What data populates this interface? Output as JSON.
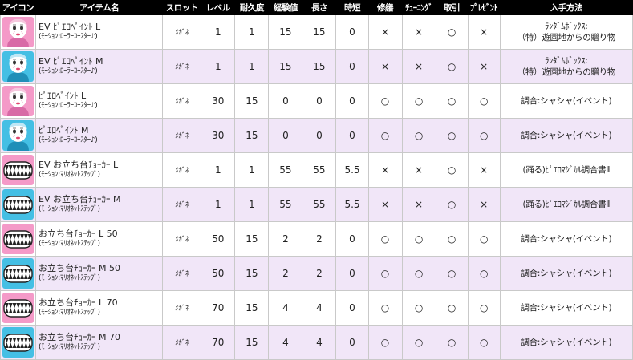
{
  "table": {
    "headers": [
      "アイコン",
      "アイテム名",
      "スロット",
      "レベル",
      "耐久度",
      "経験値",
      "長さ",
      "時短",
      "修繕",
      "ﾁｭｰﾆﾝｸﾞ",
      "取引",
      "ﾌﾟﾚｾﾞﾝﾄ",
      "入手方法"
    ],
    "rows": [
      {
        "icon": "face-pink-icon",
        "bg": "pink",
        "name": "EV ﾋﾟｴﾛﾍﾟｲﾝﾄ L",
        "sub": "(ﾓｰｼｮﾝ:ﾛｰﾗｰｺｰｽﾀｰ♪)",
        "slot": "ﾒｶﾞﾈ",
        "level": "1",
        "durability": "1",
        "exp": "15",
        "length": "15",
        "short": "0",
        "repair": "×",
        "tuning": "×",
        "trade": "○",
        "present": "×",
        "method1": "ﾗﾝﾀﾞﾑﾎﾞｯｸｽ:",
        "method2": "（特）遊園地からの贈り物"
      },
      {
        "icon": "face-blue-icon",
        "bg": "blue",
        "name": "EV ﾋﾟｴﾛﾍﾟｲﾝﾄ M",
        "sub": "(ﾓｰｼｮﾝ:ﾛｰﾗｰｺｰｽﾀｰ♪)",
        "slot": "ﾒｶﾞﾈ",
        "level": "1",
        "durability": "1",
        "exp": "15",
        "length": "15",
        "short": "0",
        "repair": "×",
        "tuning": "×",
        "trade": "○",
        "present": "×",
        "method1": "ﾗﾝﾀﾞﾑﾎﾞｯｸｽ:",
        "method2": "（特）遊園地からの贈り物"
      },
      {
        "icon": "face-pink-icon",
        "bg": "pink",
        "name": "ﾋﾟｴﾛﾍﾟｲﾝﾄ L",
        "sub": "(ﾓｰｼｮﾝ:ﾛｰﾗｰｺｰｽﾀｰ♪)",
        "slot": "ﾒｶﾞﾈ",
        "level": "30",
        "durability": "15",
        "exp": "0",
        "length": "0",
        "short": "0",
        "repair": "○",
        "tuning": "○",
        "trade": "○",
        "present": "○",
        "method1": "調合:シャシャ(イベント)",
        "method2": ""
      },
      {
        "icon": "face-blue-icon",
        "bg": "blue",
        "name": "ﾋﾟｴﾛﾍﾟｲﾝﾄ M",
        "sub": "(ﾓｰｼｮﾝ:ﾛｰﾗｰｺｰｽﾀｰ♪)",
        "slot": "ﾒｶﾞﾈ",
        "level": "30",
        "durability": "15",
        "exp": "0",
        "length": "0",
        "short": "0",
        "repair": "○",
        "tuning": "○",
        "trade": "○",
        "present": "○",
        "method1": "調合:シャシャ(イベント)",
        "method2": ""
      },
      {
        "icon": "mouth-pink-icon",
        "bg": "pink",
        "name": "EV お立ち台ﾁｮｰｶｰ L",
        "sub": "(ﾓｰｼｮﾝ:ﾏﾘｵﾈｯﾄｽﾃｯﾌﾟ)",
        "slot": "ﾒｶﾞﾈ",
        "level": "1",
        "durability": "1",
        "exp": "55",
        "length": "55",
        "short": "5.5",
        "repair": "×",
        "tuning": "×",
        "trade": "○",
        "present": "×",
        "method1": "(踊る)ﾋﾟｴﾛﾏｼﾞｶﾙ調合書Ⅱ",
        "method2": ""
      },
      {
        "icon": "mouth-blue-icon",
        "bg": "blue",
        "name": "EV お立ち台ﾁｮｰｶｰ M",
        "sub": "(ﾓｰｼｮﾝ:ﾏﾘｵﾈｯﾄｽﾃｯﾌﾟ)",
        "slot": "ﾒｶﾞﾈ",
        "level": "1",
        "durability": "1",
        "exp": "55",
        "length": "55",
        "short": "5.5",
        "repair": "×",
        "tuning": "×",
        "trade": "○",
        "present": "×",
        "method1": "(踊る)ﾋﾟｴﾛﾏｼﾞｶﾙ調合書Ⅱ",
        "method2": ""
      },
      {
        "icon": "mouth-pink-icon",
        "bg": "pink",
        "name": "お立ち台ﾁｮｰｶｰ L 50",
        "sub": "(ﾓｰｼｮﾝ:ﾏﾘｵﾈｯﾄｽﾃｯﾌﾟ)",
        "slot": "ﾒｶﾞﾈ",
        "level": "50",
        "durability": "15",
        "exp": "2",
        "length": "2",
        "short": "0",
        "repair": "○",
        "tuning": "○",
        "trade": "○",
        "present": "○",
        "method1": "調合:シャシャ(イベント)",
        "method2": ""
      },
      {
        "icon": "mouth-blue-icon",
        "bg": "blue",
        "name": "お立ち台ﾁｮｰｶｰ M 50",
        "sub": "(ﾓｰｼｮﾝ:ﾏﾘｵﾈｯﾄｽﾃｯﾌﾟ)",
        "slot": "ﾒｶﾞﾈ",
        "level": "50",
        "durability": "15",
        "exp": "2",
        "length": "2",
        "short": "0",
        "repair": "○",
        "tuning": "○",
        "trade": "○",
        "present": "○",
        "method1": "調合:シャシャ(イベント)",
        "method2": ""
      },
      {
        "icon": "mouth-pink-icon",
        "bg": "pink",
        "name": "お立ち台ﾁｮｰｶｰ L 70",
        "sub": "(ﾓｰｼｮﾝ:ﾏﾘｵﾈｯﾄｽﾃｯﾌﾟ)",
        "slot": "ﾒｶﾞﾈ",
        "level": "70",
        "durability": "15",
        "exp": "4",
        "length": "4",
        "short": "0",
        "repair": "○",
        "tuning": "○",
        "trade": "○",
        "present": "○",
        "method1": "調合:シャシャ(イベント)",
        "method2": ""
      },
      {
        "icon": "mouth-blue-icon",
        "bg": "blue",
        "name": "お立ち台ﾁｮｰｶｰ M 70",
        "sub": "(ﾓｰｼｮﾝ:ﾏﾘｵﾈｯﾄｽﾃｯﾌﾟ)",
        "slot": "ﾒｶﾞﾈ",
        "level": "70",
        "durability": "15",
        "exp": "4",
        "length": "4",
        "short": "0",
        "repair": "○",
        "tuning": "○",
        "trade": "○",
        "present": "○",
        "method1": "調合:シャシャ(イベント)",
        "method2": ""
      }
    ]
  },
  "colors": {
    "header_bg": "#000000",
    "header_text": "#ffffff",
    "row_alt_bg": "#f1e6f8",
    "icon_pink": "#f49ac8",
    "icon_blue": "#44bfe4"
  }
}
